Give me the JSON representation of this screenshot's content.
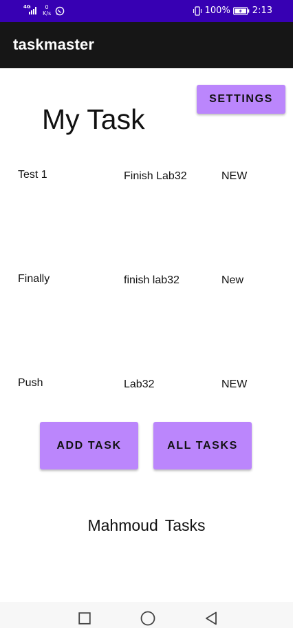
{
  "status_bar": {
    "network_label": "4G",
    "speed_value": "0",
    "speed_unit": "K/s",
    "battery_percent": "100%",
    "time": "2:13",
    "icons": [
      "signal-icon",
      "whatsapp-icon",
      "vibrate-icon",
      "battery-charging-icon"
    ],
    "background_color": "#3700b3"
  },
  "app_bar": {
    "title": "taskmaster",
    "background_color": "#161616"
  },
  "settings_button": {
    "label": "SETTINGS"
  },
  "page_title": "My Task",
  "tasks": [
    {
      "title": "Test 1",
      "body": "Finish Lab32",
      "state": "NEW"
    },
    {
      "title": "Finally",
      "body": "finish lab32",
      "state": "New"
    },
    {
      "title": "Push",
      "body": "Lab32",
      "state": "NEW"
    }
  ],
  "actions": {
    "add_task": "ADD TASK",
    "all_tasks": "ALL TASKS"
  },
  "footer_name": "Mahmoud  Tasks",
  "nav_bar": {
    "icons": [
      "recents-square-icon",
      "home-circle-icon",
      "back-triangle-icon"
    ]
  },
  "accent_color": "#bb86fc"
}
